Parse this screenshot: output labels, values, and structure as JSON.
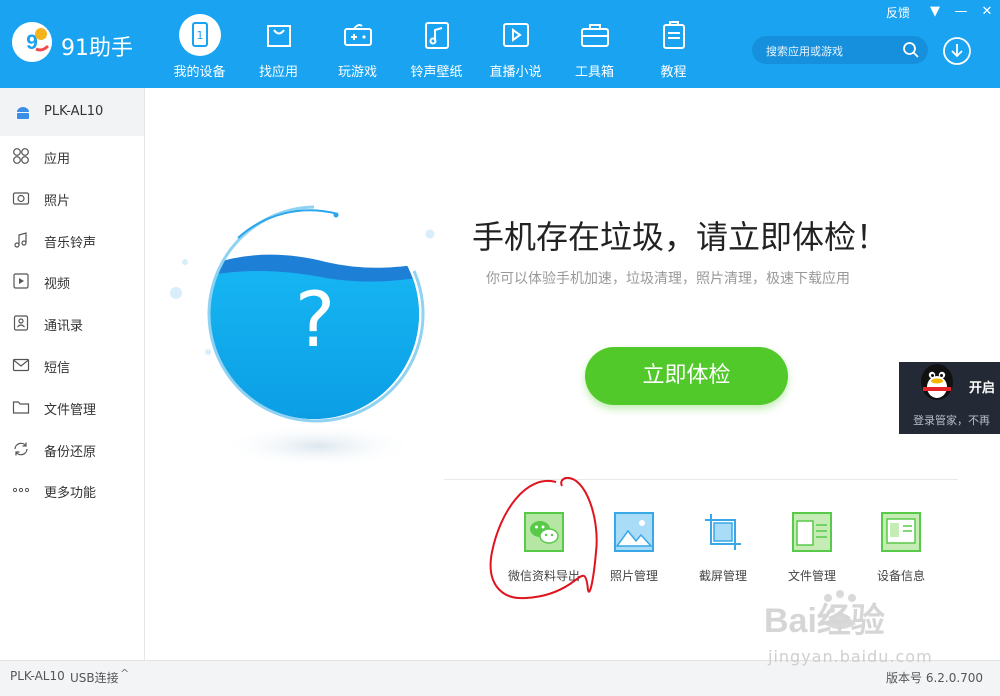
{
  "app": {
    "name": "91助手"
  },
  "top_right": {
    "feedback": "反馈",
    "menu": "▼",
    "minimize": "—",
    "close": "✕"
  },
  "nav": [
    {
      "label": "我的设备",
      "icon": "device-icon",
      "badge": "1"
    },
    {
      "label": "找应用",
      "icon": "bag-icon"
    },
    {
      "label": "玩游戏",
      "icon": "gamepad-icon"
    },
    {
      "label": "铃声壁纸",
      "icon": "music-note-icon"
    },
    {
      "label": "直播小说",
      "icon": "play-icon"
    },
    {
      "label": "工具箱",
      "icon": "toolbox-icon"
    },
    {
      "label": "教程",
      "icon": "clipboard-icon"
    }
  ],
  "search": {
    "placeholder": "搜索应用或游戏"
  },
  "sidebar": {
    "device": "PLK-AL10",
    "items": [
      {
        "label": "应用",
        "icon": "apps-grid-icon"
      },
      {
        "label": "照片",
        "icon": "camera-icon"
      },
      {
        "label": "音乐铃声",
        "icon": "music-note-icon"
      },
      {
        "label": "视频",
        "icon": "video-icon"
      },
      {
        "label": "通讯录",
        "icon": "contacts-icon"
      },
      {
        "label": "短信",
        "icon": "message-icon"
      },
      {
        "label": "文件管理",
        "icon": "folder-icon"
      },
      {
        "label": "备份还原",
        "icon": "refresh-icon"
      },
      {
        "label": "更多功能",
        "icon": "more-dots-icon"
      }
    ]
  },
  "main": {
    "headline": "手机存在垃圾，请立即体检！",
    "subline": "你可以体验手机加速，垃圾清理，照片清理，极速下载应用",
    "globe_symbol": "?",
    "check_button": "立即体检",
    "tools": [
      {
        "label": "微信资料导出",
        "icon": "wechat-icon"
      },
      {
        "label": "照片管理",
        "icon": "photo-icon"
      },
      {
        "label": "截屏管理",
        "icon": "crop-icon"
      },
      {
        "label": "文件管理",
        "icon": "file-manager-icon"
      },
      {
        "label": "设备信息",
        "icon": "device-info-icon"
      }
    ]
  },
  "qq_popup": {
    "title": "开启",
    "subtitle": "登录管家，不再"
  },
  "status": {
    "device": "PLK-AL10",
    "connection": "USB连接",
    "chevron": "^",
    "version": "版本号 6.2.0.700"
  },
  "watermark": {
    "brand": "Bai经验",
    "url": "jingyan.baidu.com"
  },
  "colors": {
    "header": "#1aa3f0",
    "accent_green": "#52c92a",
    "globe_blue": "#0fb0ef",
    "tool_green": "#59c94a",
    "annotation_red": "#e0141e"
  }
}
